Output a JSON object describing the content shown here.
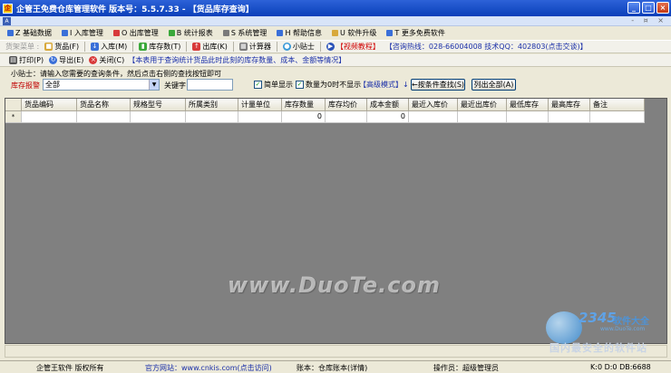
{
  "window": {
    "title": "企管王免费仓库管理软件  版本号：5.5.7.33 - 【货品库存查询】",
    "controls": [
      "_",
      "□",
      "×"
    ]
  },
  "mdi": {
    "icon": "A",
    "controls": "- ¤ ×"
  },
  "menu": [
    {
      "label": "Z 基础数据",
      "color": "#3a6fd8"
    },
    {
      "label": "I 入库管理",
      "color": "#3a6fd8"
    },
    {
      "label": "O 出库管理",
      "color": "#d83a3a"
    },
    {
      "label": "B 统计报表",
      "color": "#3aa83a"
    },
    {
      "label": "S 系统管理",
      "color": "#7a7a7a"
    },
    {
      "label": "H 帮助信息",
      "color": "#3a6fd8"
    },
    {
      "label": "U 软件升级",
      "color": "#d8a83a"
    },
    {
      "label": "T 更多免费软件",
      "color": "#3a6fd8"
    }
  ],
  "toolbar1": {
    "disabled": "货架菜单 :",
    "buttons": [
      {
        "label": "货品(F)",
        "color": "#d8a83a"
      },
      {
        "label": "入库(M)",
        "color": "#3a6fd8"
      },
      {
        "label": "库存数(T)",
        "color": "#3aa83a"
      },
      {
        "label": "出库(K)",
        "color": "#d83a3a"
      },
      {
        "label": "计算器",
        "color": "#7a7a7a"
      },
      {
        "label": "小贴士",
        "color": "#3a9ad8"
      }
    ],
    "video": "【视频教程】",
    "hotline": "【咨询热线：028-66004008  技术QQ：402803(点击交谈)】"
  },
  "toolbar2": {
    "print": "打印(P)",
    "export": "导出(E)",
    "close": "关闭(C)",
    "notice": "【本表用于查询统计货品此时此刻的库存数量、成本、金额等情况】"
  },
  "tip": "小贴士：请输入您需要的查询条件，然后点击右侧的查找按钮即可",
  "filter": {
    "alert_label": "库存报警",
    "select_value": "全部",
    "keyword_label": "关键字",
    "keyword_value": "",
    "simple_display": "简单显示",
    "hide_zero": "数量为0时不显示",
    "advanced": "【高级模式】↓",
    "search_btn": "←按条件查找(S)",
    "list_all_btn": "列出全部(A)"
  },
  "table": {
    "columns": [
      "货品编码",
      "货品名称",
      "规格型号",
      "所属类别",
      "计量单位",
      "库存数量",
      "库存均价",
      "成本金额",
      "最近入库价",
      "最近出库价",
      "最低库存",
      "最高库存",
      "备注"
    ],
    "row": [
      "",
      "",
      "",
      "",
      "",
      "0",
      "",
      "0",
      "",
      "",
      "",
      "",
      ""
    ],
    "row_marker": "*"
  },
  "status": {
    "company": "企管王软件  版权所有",
    "website": "官方网站：www.cnkis.com(点击访问)",
    "account": "账本：仓库账本(详情)",
    "operator": "操作员：超级管理员",
    "db": "K:0 D:0 DB:6688"
  },
  "watermark": "www.DuoTe.com",
  "brand": {
    "number": "2345",
    "name": "软件大全",
    "url": "www.DuoTe.com",
    "slogan": "国内最安全的软件站"
  }
}
